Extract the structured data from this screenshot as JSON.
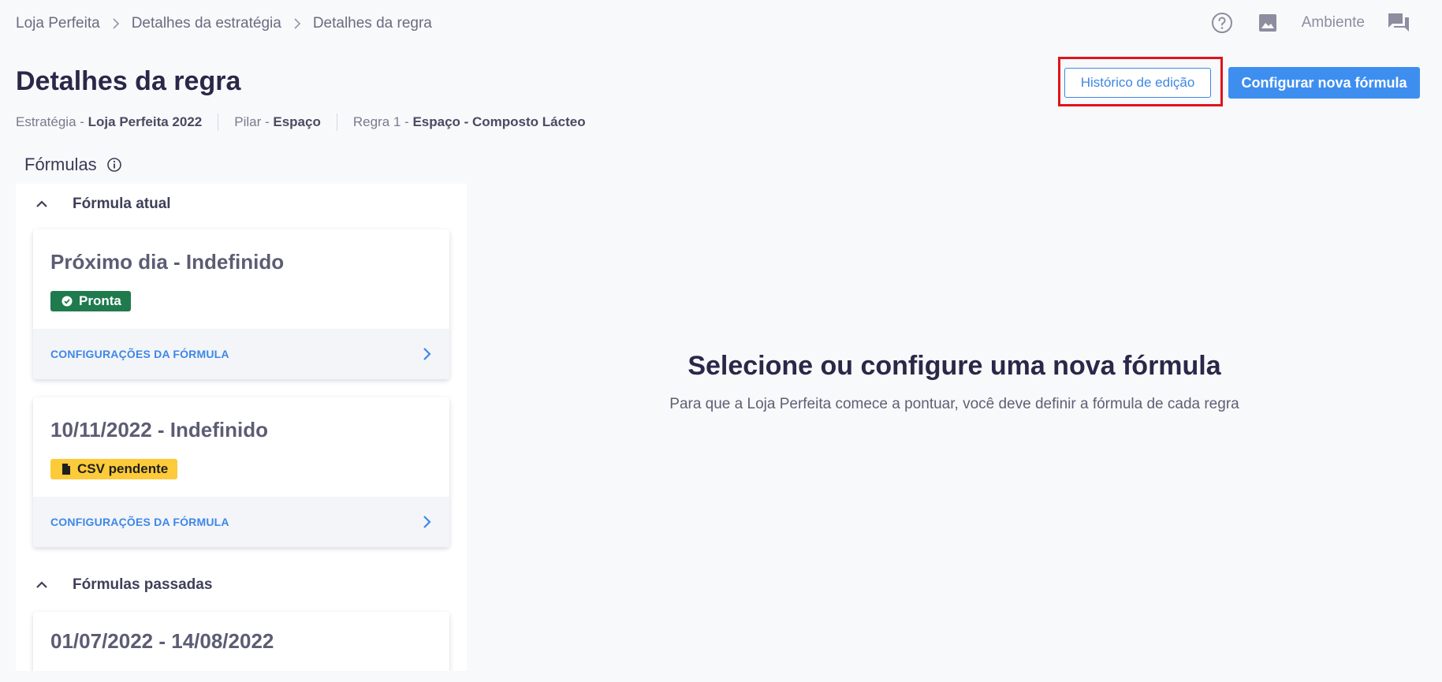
{
  "breadcrumb": [
    "Loja Perfeita",
    "Detalhes da estratégia",
    "Detalhes da regra"
  ],
  "topbar": {
    "environment_label": "Ambiente"
  },
  "page": {
    "title": "Detalhes da regra",
    "meta": [
      {
        "label": "Estratégia - ",
        "value": "Loja Perfeita 2022"
      },
      {
        "label": "Pilar - ",
        "value": "Espaço"
      },
      {
        "label": "Regra 1 - ",
        "value": "Espaço - Composto Lácteo"
      }
    ]
  },
  "actions": {
    "history_label": "Histórico de edição",
    "new_formula_label": "Configurar nova fórmula"
  },
  "formulas": {
    "heading": "Fórmulas",
    "current_section": "Fórmula atual",
    "past_section": "Fórmulas passadas",
    "current": [
      {
        "title": "Próximo dia - Indefinido",
        "status": "Pronta",
        "link": "CONFIGURAÇÕES DA FÓRMULA"
      },
      {
        "title": "10/11/2022 - Indefinido",
        "status": "CSV pendente",
        "link": "CONFIGURAÇÕES DA FÓRMULA"
      }
    ],
    "past": [
      {
        "title": "01/07/2022 - 14/08/2022"
      }
    ]
  },
  "empty_state": {
    "title": "Selecione ou configure uma nova fórmula",
    "description": "Para que a Loja Perfeita comece a pontuar, você deve definir a fórmula de cada regra"
  },
  "colors": {
    "primary": "#3e8ef0",
    "ready_badge": "#1f7a4e",
    "pending_badge": "#fdcb3a",
    "highlight": "#e0131b"
  }
}
